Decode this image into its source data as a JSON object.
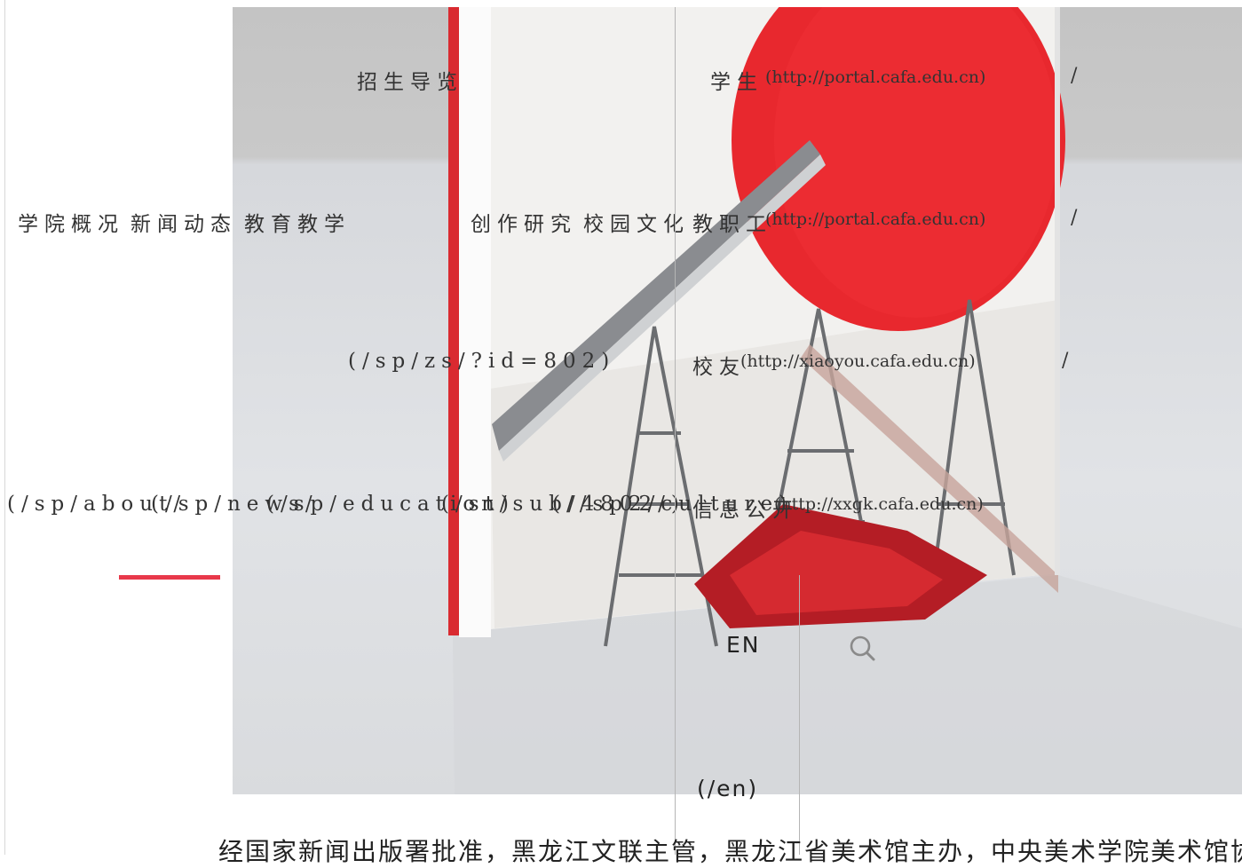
{
  "nav": {
    "items": [
      {
        "label": "学院概况",
        "link": "(/sp/about/"
      },
      {
        "label": "新闻动态",
        "link": "(/sp/news/"
      },
      {
        "label": "教育教学",
        "link": "(/sp/education)"
      },
      {
        "label": "招生导览",
        "link": "(/sp/zs/?id=802)"
      },
      {
        "label": "创作研究",
        "link": "(/st/sub/4802/)"
      },
      {
        "label": "校园文化",
        "link": "(//sp2/culture)"
      }
    ],
    "active_underline_color": "#e8384a"
  },
  "right_links": [
    {
      "label": "学生",
      "url": "(http://portal.cafa.edu.cn)",
      "sep": "/"
    },
    {
      "label": "教职工",
      "url": "(http://portal.cafa.edu.cn)",
      "sep": "/"
    },
    {
      "label": "校友",
      "url": "(http://xiaoyou.cafa.edu.cn)",
      "sep": "/"
    },
    {
      "label": "信息公开",
      "url": "(http://xxgk.cafa.edu.cn)"
    }
  ],
  "lang": {
    "label": "EN",
    "link": "(/en)"
  },
  "icons": {
    "search": "search-icon"
  },
  "caption": "经国家新闻出版署批准，黑龙江文联主管，黑龙江省美术馆主办，中央美术学院美术馆协",
  "hero_colors": {
    "red": "#e8282e",
    "band": "#c6c6c6"
  }
}
